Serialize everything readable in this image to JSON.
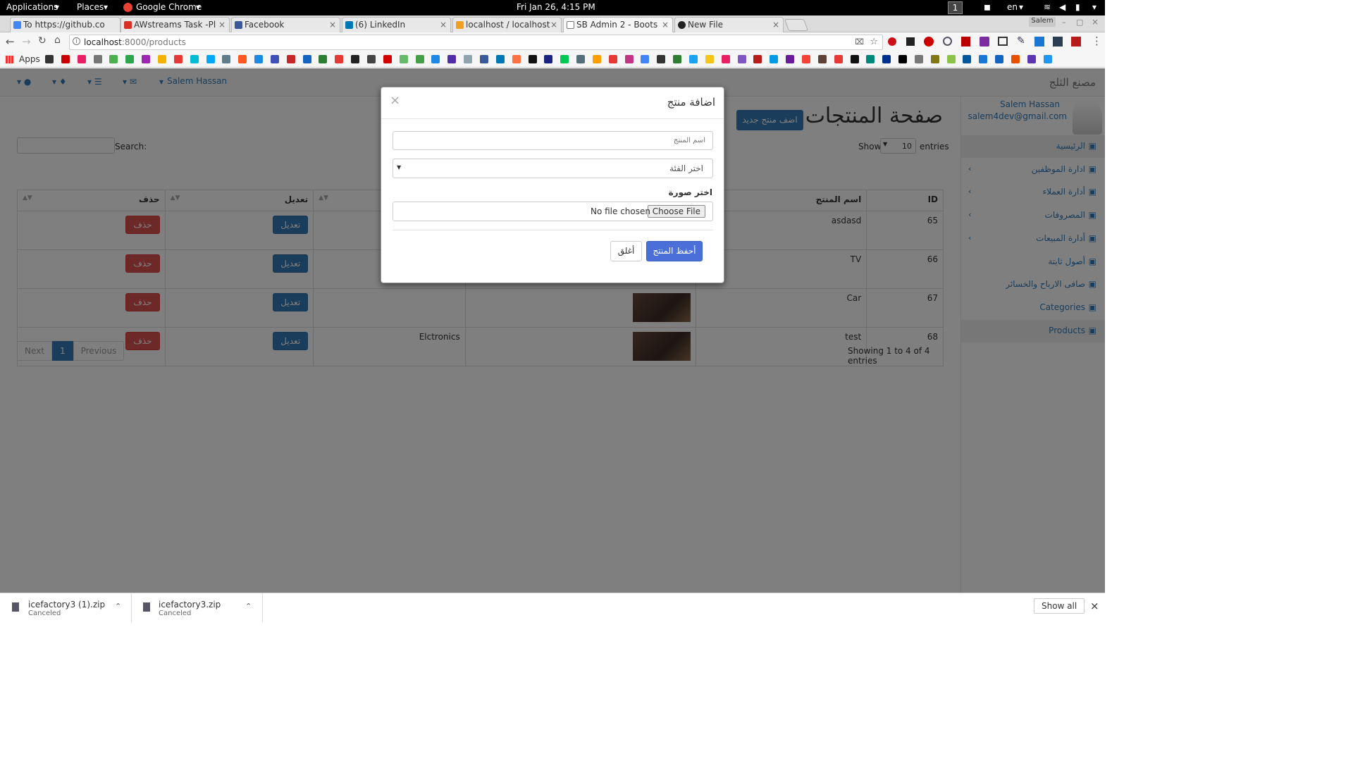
{
  "system_bar": {
    "applications": "Applications",
    "places": "Places",
    "browser": "Google Chrome",
    "datetime": "Fri Jan 26,  4:15 PM",
    "workspace": "1",
    "lang": "en"
  },
  "tabs": [
    {
      "title": "To https://github.co",
      "color": "#4285f4"
    },
    {
      "title": "AWstreams Task -Pl",
      "color": "#d93025"
    },
    {
      "title": "Facebook",
      "color": "#3b5998"
    },
    {
      "title": "(6) LinkedIn",
      "color": "#0077b5"
    },
    {
      "title": "localhost / localhost",
      "color": "#f0a020"
    },
    {
      "title": "SB Admin 2 - Boots",
      "color": "#777777"
    },
    {
      "title": "New File",
      "color": "#222222"
    }
  ],
  "window_user": "Salem",
  "address": {
    "url_host": "localhost",
    "url_rest": ":8000/products"
  },
  "bookmarks": {
    "apps_label": "Apps"
  },
  "navbar": {
    "brand": "مصنع الثلج",
    "user_name": "Salem Hassan"
  },
  "sidebar": {
    "profile_name": "Salem Hassan",
    "profile_email": "salem4dev@gmail.com",
    "items": [
      {
        "label": "الرئيسية",
        "has_children": false
      },
      {
        "label": "ادارة الموظفين",
        "has_children": true
      },
      {
        "label": "أدارة العملاء",
        "has_children": true
      },
      {
        "label": "المصروفات",
        "has_children": true
      },
      {
        "label": "أدارة المبيعات",
        "has_children": true
      },
      {
        "label": "أصول ثابتة",
        "has_children": false
      },
      {
        "label": "صافى الارباح والخسائر",
        "has_children": false
      },
      {
        "label": "Categories",
        "has_children": false
      },
      {
        "label": "Products",
        "has_children": false
      }
    ]
  },
  "page": {
    "heading": "صفحة المنتجات",
    "add_button": "اضف منتج جديد",
    "show_label": "Show",
    "entries_value": "10",
    "entries_label": "entries",
    "search_label": "Search:",
    "table": {
      "headers": [
        "ID",
        "اسم المنتج",
        "",
        "",
        "تعديل",
        "حذف"
      ],
      "rows": [
        {
          "id": "65",
          "name": "asdasd",
          "category": "",
          "edit": "تعديل",
          "delete": "حذف"
        },
        {
          "id": "66",
          "name": "TV",
          "category": "",
          "edit": "تعديل",
          "delete": "حذف"
        },
        {
          "id": "67",
          "name": "Car",
          "category": "",
          "edit": "تعديل",
          "delete": "حذف"
        },
        {
          "id": "68",
          "name": "test",
          "category": "Elctronics",
          "edit": "تعديل",
          "delete": "حذف"
        }
      ]
    },
    "info": "Showing 1 to 4 of 4 entries",
    "pagination": {
      "next": "Next",
      "page": "1",
      "previous": "Previous"
    }
  },
  "modal": {
    "title": "اضافة منتج",
    "close": "×",
    "name_placeholder": "اسم المنتج",
    "category_placeholder": "اختر الفئة",
    "image_label": "اختر صورة",
    "file_button": "Choose File",
    "file_status": "No file chosen",
    "save_button": "أحفظ المنتج",
    "close_button": "أغلق"
  },
  "downloads": {
    "items": [
      {
        "name": "icefactory3 (1).zip",
        "status": "Canceled"
      },
      {
        "name": "icefactory3.zip",
        "status": "Canceled"
      }
    ],
    "show_all": "Show all"
  },
  "colors": {
    "primary": "#337ab7",
    "danger": "#d9534f",
    "modal_save": "#4a6fd8"
  }
}
